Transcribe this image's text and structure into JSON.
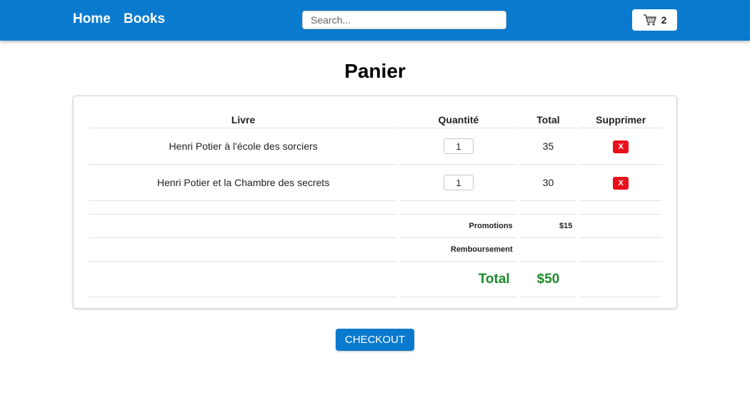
{
  "nav": {
    "home_label": "Home",
    "books_label": "Books",
    "search_placeholder": "Search...",
    "cart_count": "2",
    "cart_icon": "shopping-cart-icon",
    "bar_color": "#0a7acf"
  },
  "page": {
    "title": "Panier"
  },
  "table": {
    "headers": {
      "book": "Livre",
      "quantity": "Quantité",
      "total": "Total",
      "delete": "Supprimer"
    },
    "items": [
      {
        "title": "Henri Potier à l'école des sorciers",
        "quantity": "1",
        "total": "35",
        "delete_label": "X"
      },
      {
        "title": "Henri Potier et la Chambre des secrets",
        "quantity": "1",
        "total": "30",
        "delete_label": "X"
      }
    ],
    "summary": {
      "promotions_label": "Promotions",
      "promotions_value": "$15",
      "refund_label": "Remboursement",
      "refund_value": "",
      "total_label": "Total",
      "total_value": "$50"
    }
  },
  "checkout_label": "CHECKOUT",
  "colors": {
    "primary": "#0a7acf",
    "danger": "#e8101c",
    "success": "#1d8a2a"
  }
}
